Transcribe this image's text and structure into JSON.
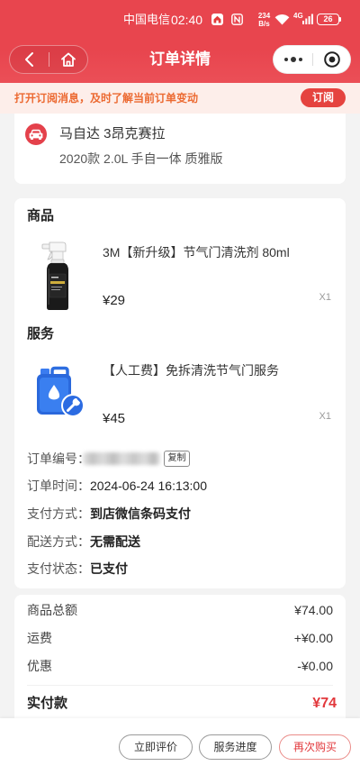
{
  "status_bar": {
    "carrier": "中国电信",
    "time": "02:40",
    "net_speed": "234",
    "net_speed_unit": "B/s",
    "network": "4G",
    "battery": "26"
  },
  "nav": {
    "title": "订单详情"
  },
  "banner": {
    "text": "打开订阅消息，及时了解当前订单变动",
    "button": "订阅"
  },
  "vehicle": {
    "name": "马自达 3昂克赛拉",
    "spec": "2020款 2.0L 手自一体 质雅版"
  },
  "goods": {
    "heading": "商品",
    "items": [
      {
        "name": "3M【新升级】节气门清洗剂 80ml",
        "price": "¥29",
        "qty": "X1"
      }
    ]
  },
  "services": {
    "heading": "服务",
    "items": [
      {
        "name": "【人工费】免拆清洗节气门服务",
        "price": "¥45",
        "qty": "X1"
      }
    ]
  },
  "order_info": {
    "number_label": "订单编号：",
    "copy_button": "复制",
    "rows": [
      {
        "label": "订单时间：",
        "value": "2024-06-24 16:13:00"
      },
      {
        "label": "支付方式：",
        "value": "到店微信条码支付"
      },
      {
        "label": "配送方式：",
        "value": "无需配送"
      },
      {
        "label": "支付状态：",
        "value": "已支付"
      }
    ]
  },
  "totals": {
    "rows": [
      {
        "label": "商品总额",
        "value": "¥74.00"
      },
      {
        "label": "运费",
        "value": "+¥0.00"
      },
      {
        "label": "优惠",
        "value": "-¥0.00"
      }
    ],
    "paid_label": "实付款",
    "paid_value": "¥74"
  },
  "actions": {
    "review": "立即评价",
    "progress": "服务进度",
    "rebuy": "再次购买"
  },
  "icons": {
    "back": "chevron-left-icon",
    "home": "home-icon",
    "more": "more-dots-icon",
    "close": "target-circle-icon",
    "vehicle": "car-icon",
    "status": [
      "app-notification-icon",
      "nfc-icon",
      "wifi-icon",
      "signal-icon",
      "battery-icon"
    ]
  },
  "colors": {
    "header": "#e8454e",
    "accent": "#e5433f",
    "price_red": "#e2383c",
    "banner_bg": "#fdeeea",
    "banner_text": "#ec6a32",
    "page_bg": "#f3f3f3"
  }
}
